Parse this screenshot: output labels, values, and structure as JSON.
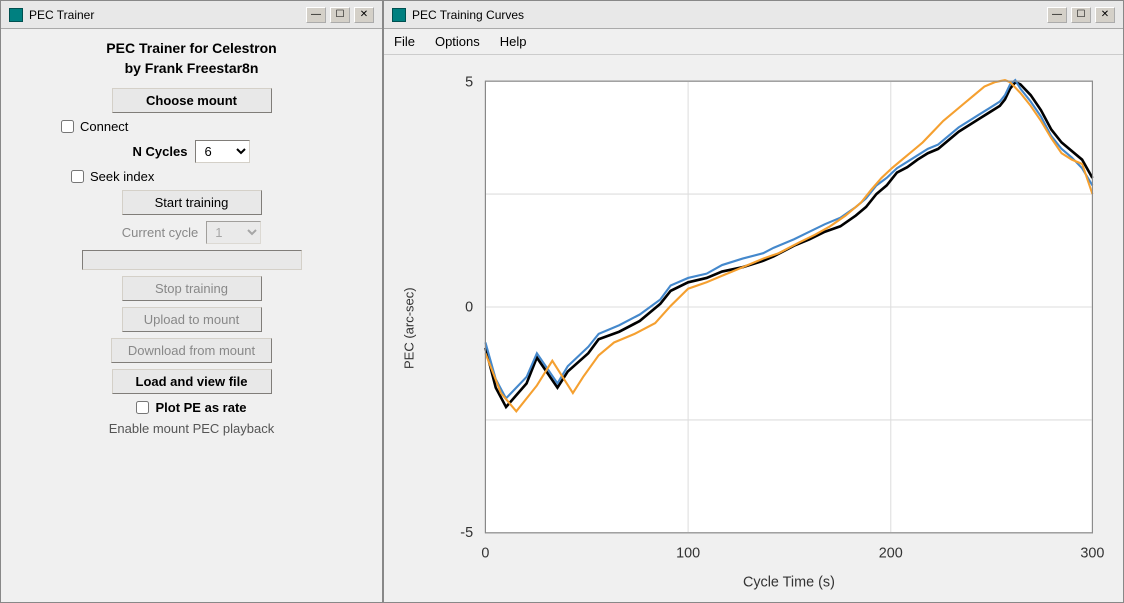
{
  "left_window": {
    "title": "PEC Trainer",
    "titlebar_controls": [
      "—",
      "☐",
      "✕"
    ]
  },
  "right_window": {
    "title": "PEC Training Curves",
    "titlebar_controls": [
      "—",
      "☐",
      "✕"
    ]
  },
  "app": {
    "title_line1": "PEC Trainer for Celestron",
    "title_line2": "by Frank Freestar8n"
  },
  "menu": {
    "items": [
      "File",
      "Options",
      "Help"
    ]
  },
  "controls": {
    "choose_mount": "Choose mount",
    "connect_label": "Connect",
    "n_cycles_label": "N Cycles",
    "n_cycles_value": "6",
    "seek_index_label": "Seek index",
    "start_training": "Start training",
    "current_cycle_label": "Current cycle",
    "current_cycle_value": "1",
    "stop_training": "Stop training",
    "upload_to_mount": "Upload to mount",
    "download_from_mount": "Download from mount",
    "load_and_view_file": "Load and view file",
    "plot_pe_label": "Plot PE as rate",
    "enable_mount_pec": "Enable mount PEC playback"
  },
  "chart": {
    "y_label": "PEC (arc-sec)",
    "x_label": "Cycle Time (s)",
    "y_ticks": [
      "5",
      "0",
      "-5"
    ],
    "x_ticks": [
      "0",
      "100",
      "200",
      "300"
    ],
    "colors": {
      "black": "#000000",
      "blue": "#4488cc",
      "orange": "#f5a030"
    }
  }
}
